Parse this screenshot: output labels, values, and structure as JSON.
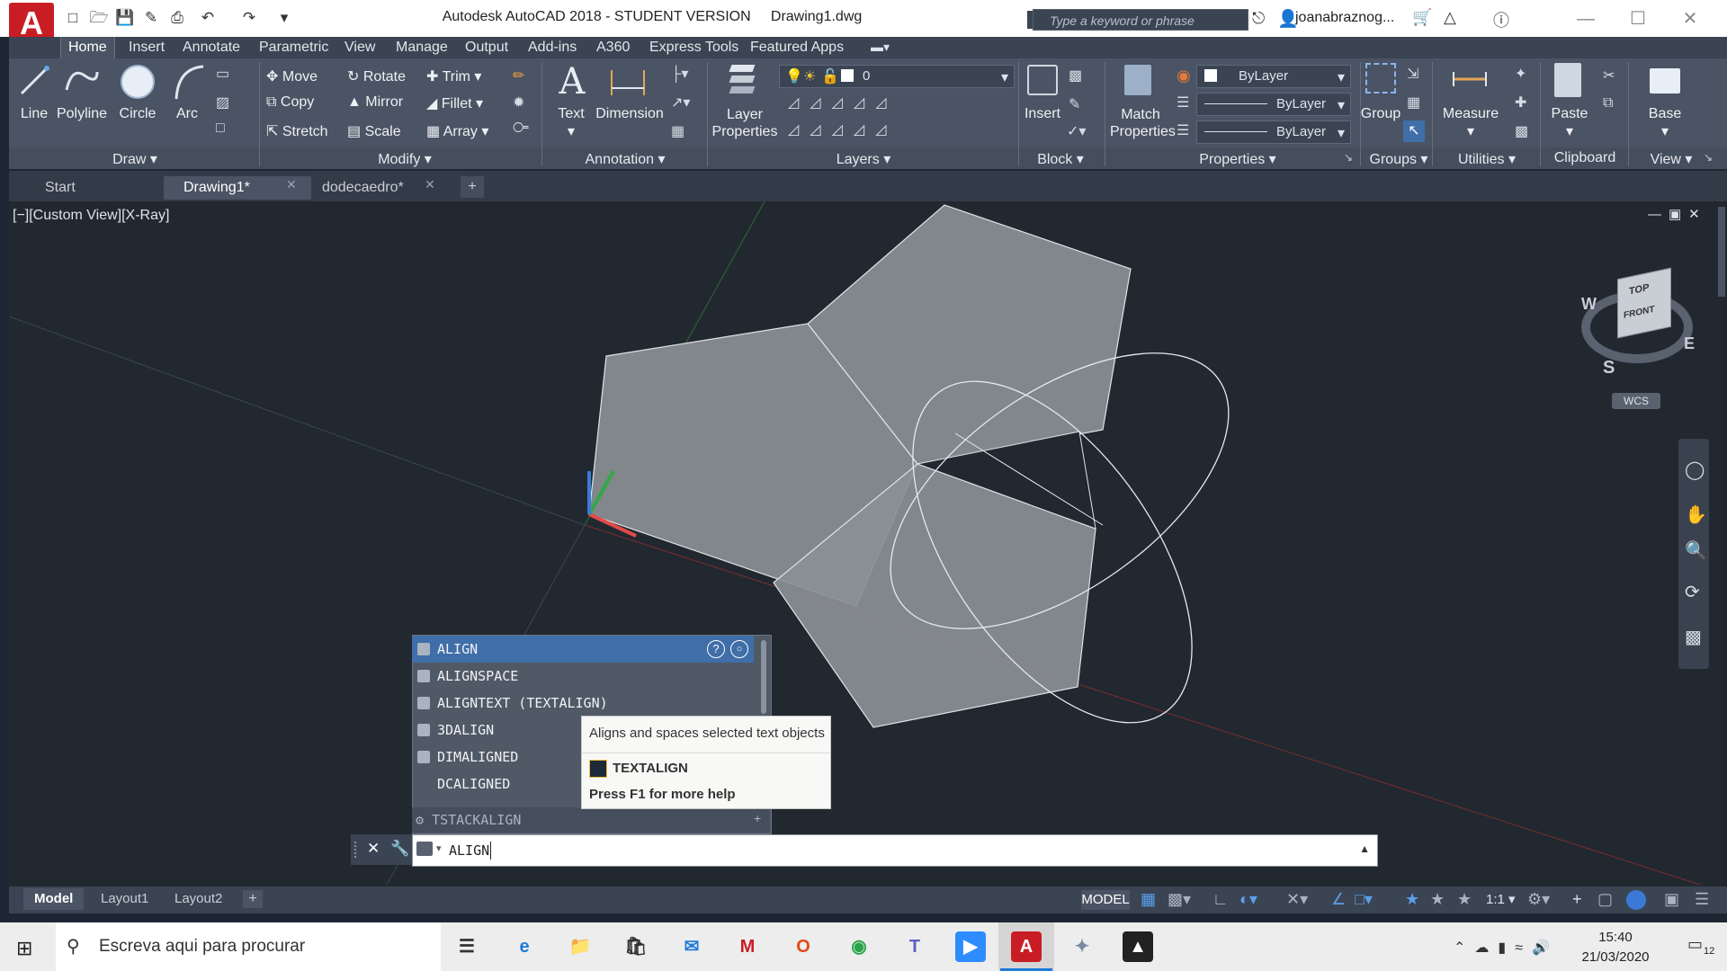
{
  "app": {
    "title": "Autodesk AutoCAD 2018 - STUDENT VERSION",
    "document": "Drawing1.dwg",
    "logo_letter": "A",
    "search_placeholder": "Type a keyword or phrase",
    "user": "joanabraznog..."
  },
  "ribbon_tabs": [
    "Home",
    "Insert",
    "Annotate",
    "Parametric",
    "View",
    "Manage",
    "Output",
    "Add-ins",
    "A360",
    "Express Tools",
    "Featured Apps"
  ],
  "draw_panel": {
    "title": "Draw",
    "tools": [
      "Line",
      "Polyline",
      "Circle",
      "Arc"
    ]
  },
  "modify_panel": {
    "title": "Modify",
    "col1": [
      "Move",
      "Copy",
      "Stretch"
    ],
    "col2": [
      "Rotate",
      "Mirror",
      "Scale"
    ],
    "col3": [
      "Trim",
      "Fillet",
      "Array"
    ]
  },
  "annotation_panel": {
    "title": "Annotation",
    "tools": [
      "Text",
      "Dimension"
    ]
  },
  "layers_panel": {
    "title": "Layers",
    "tool_line1": "Layer",
    "tool_line2": "Properties",
    "current_layer": "0"
  },
  "block_panel": {
    "title": "Block",
    "tool": "Insert"
  },
  "properties_panel": {
    "title": "Properties",
    "tool_line1": "Match",
    "tool_line2": "Properties",
    "color": "ByLayer",
    "linetype": "ByLayer",
    "lineweight": "ByLayer"
  },
  "groups_panel": {
    "title": "Groups",
    "tool": "Group"
  },
  "utilities_panel": {
    "title": "Utilities",
    "tool": "Measure"
  },
  "clipboard_panel": {
    "title": "Clipboard",
    "tool": "Paste"
  },
  "view_panel": {
    "title": "View",
    "tool": "Base"
  },
  "file_tabs": [
    "Start",
    "Drawing1*",
    "dodecaedro*"
  ],
  "viewport": {
    "label": "[−][Custom View][X-Ray]",
    "viewcube": {
      "top": "TOP",
      "front": "FRONT",
      "w": "W",
      "e": "E",
      "s": "S",
      "wcs": "WCS"
    }
  },
  "autocomplete": {
    "items": [
      "ALIGN",
      "ALIGNSPACE",
      "ALIGNTEXT (TEXTALIGN)",
      "3DALIGN",
      "DIMALIGNED",
      "DCALIGNED"
    ],
    "footer": "TSTACKALIGN",
    "tooltip": {
      "description": "Aligns and spaces selected text objects",
      "command": "TEXTALIGN",
      "help": "Press F1 for more help"
    }
  },
  "command_line": {
    "value": "ALIGN"
  },
  "layout_tabs": [
    "Model",
    "Layout1",
    "Layout2"
  ],
  "status": {
    "mode": "MODEL",
    "scale": "1:1"
  },
  "taskbar": {
    "search_placeholder": "Escreva aqui para procurar",
    "time": "15:40",
    "date": "21/03/2020",
    "notifications": "12"
  },
  "colors": {
    "accent_red": "#c91d25",
    "selection_blue": "#3f6ea8",
    "ribbon_bg": "#4b5464",
    "viewport_bg": "#212830"
  }
}
